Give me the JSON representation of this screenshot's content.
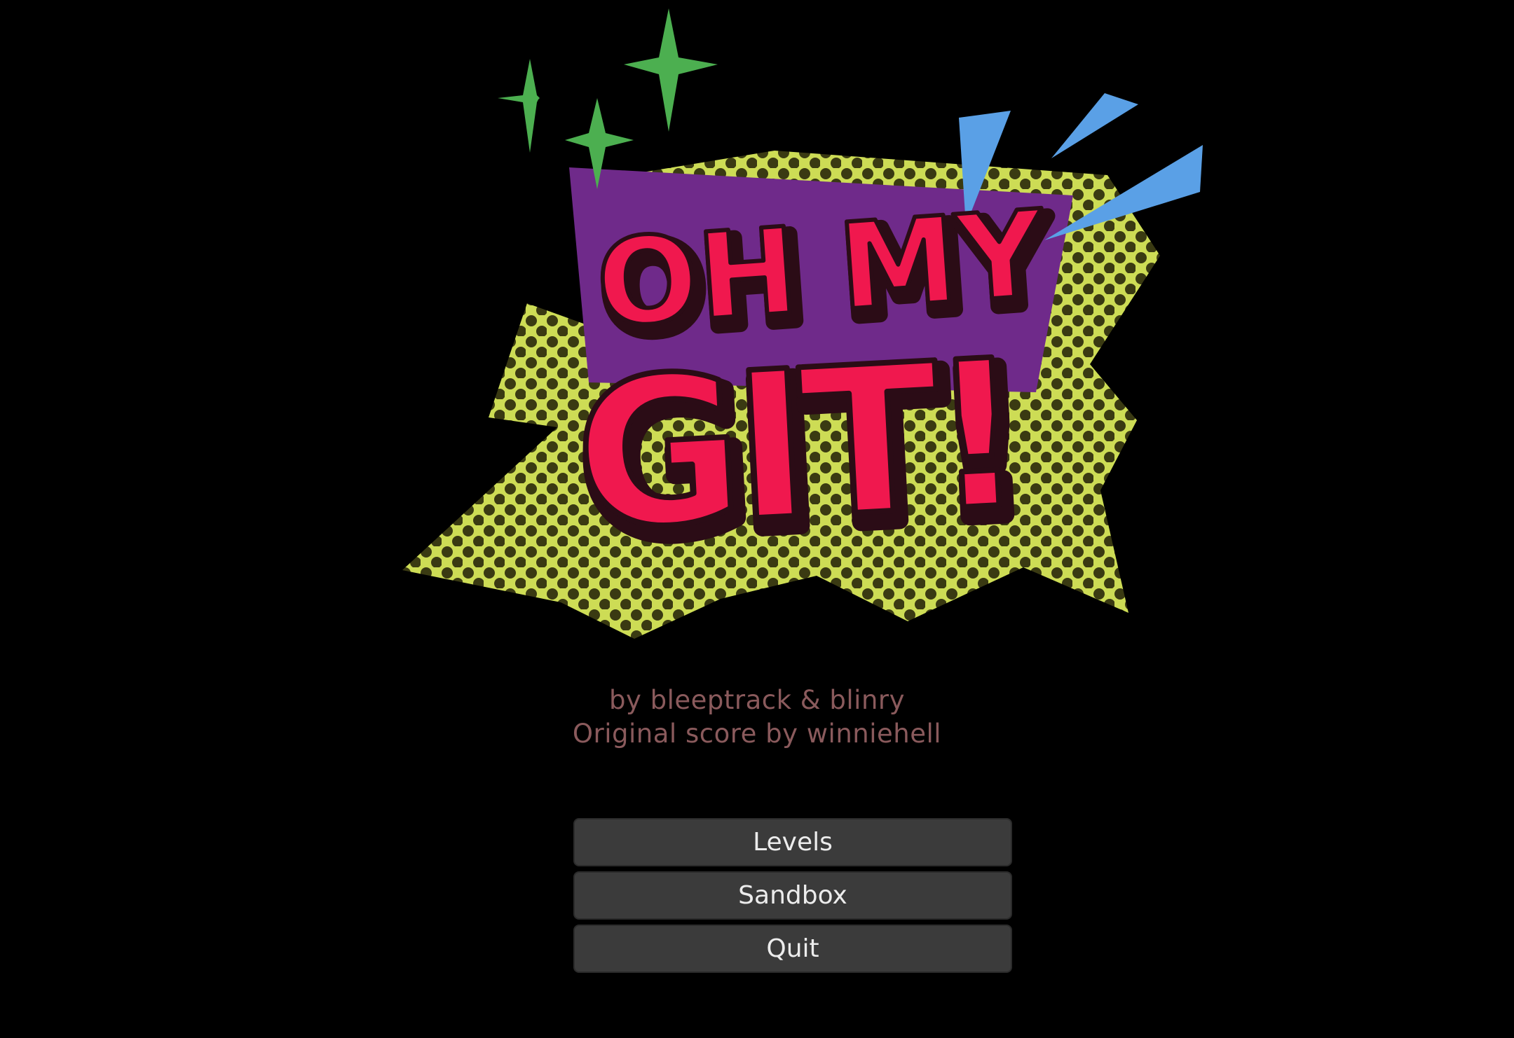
{
  "logo": {
    "line1": "OH MY",
    "line2": "GIT!"
  },
  "credits": {
    "authors": "by bleeptrack & blinry",
    "score": "Original score by winniehell"
  },
  "menu": {
    "levels_label": "Levels",
    "sandbox_label": "Sandbox",
    "quit_label": "Quit"
  },
  "colors": {
    "background": "#000000",
    "title_pink": "#f0184e",
    "title_outline": "#2b0c16",
    "purple_panel": "#6f2a8a",
    "burst_yellow": "#cddc55",
    "sparkle_green": "#4caf50",
    "streak_blue": "#5aa0e6",
    "credits_text": "#8a5a5c",
    "button_bg": "#3b3b3b",
    "button_text": "#ececec"
  }
}
